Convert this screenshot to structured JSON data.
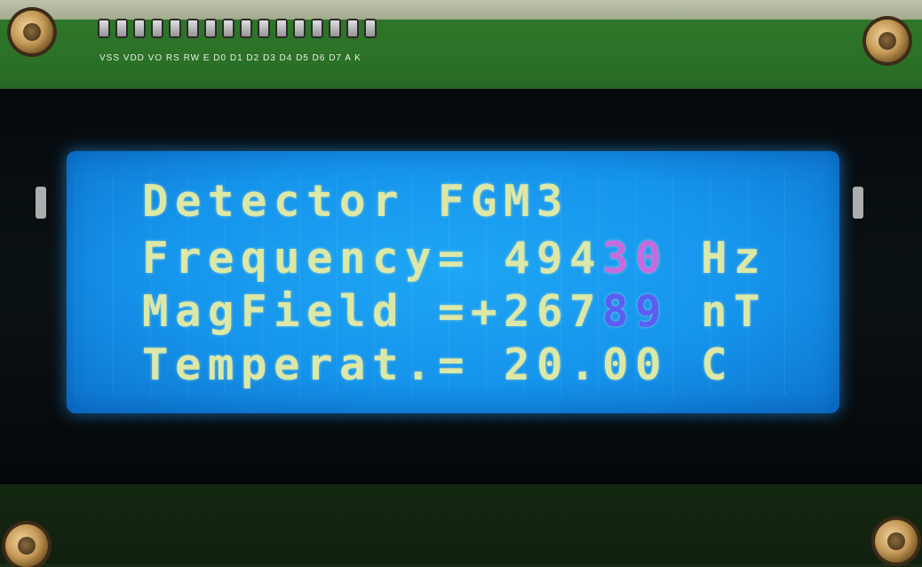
{
  "board": {
    "pin_labels": "VSS VDD VO RS RW E D0 D1 D2 D3 D4 D5 D6 D7 A K"
  },
  "lcd": {
    "line1": "Detector FGM3",
    "line2_prefix": "Frequency= 494",
    "line2_highlight": "30",
    "line2_suffix": " Hz",
    "line3_prefix": "MagField =+267",
    "line3_highlight": "89",
    "line3_suffix": " nT",
    "line4": "Temperat.= 20.00 C"
  },
  "colors": {
    "backlight": "#1594ec",
    "text": "#dce8a6",
    "accent1": "#c86adf",
    "accent2": "#5b5df3"
  }
}
